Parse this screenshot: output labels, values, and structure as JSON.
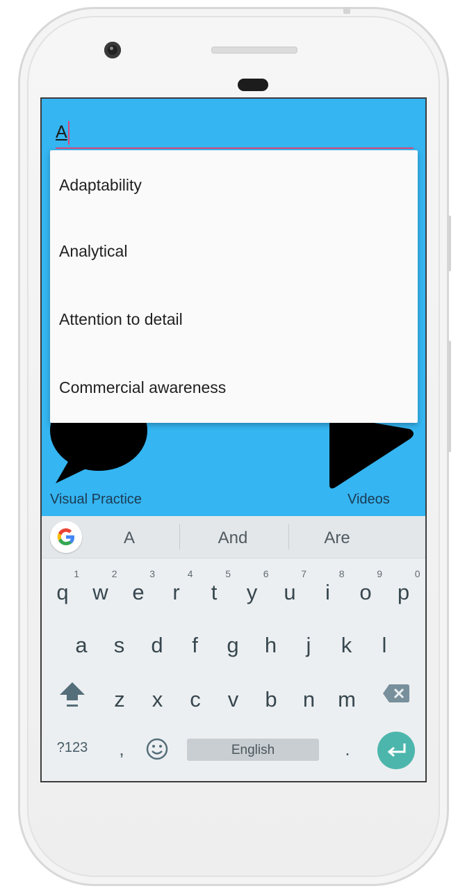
{
  "input": {
    "value": "A"
  },
  "autocomplete": {
    "items": [
      "Adaptability",
      "Analytical",
      "Attention to detail",
      "Commercial awareness"
    ]
  },
  "tiles": {
    "left_caption": "Visual Practice",
    "right_caption": "Videos",
    "left_icon": "speech-bubble-icon",
    "right_icon": "play-icon"
  },
  "keyboard": {
    "suggestions": [
      "A",
      "And",
      "Are"
    ],
    "row1": [
      {
        "key": "q",
        "num": "1"
      },
      {
        "key": "w",
        "num": "2"
      },
      {
        "key": "e",
        "num": "3"
      },
      {
        "key": "r",
        "num": "4"
      },
      {
        "key": "t",
        "num": "5"
      },
      {
        "key": "y",
        "num": "6"
      },
      {
        "key": "u",
        "num": "7"
      },
      {
        "key": "i",
        "num": "8"
      },
      {
        "key": "o",
        "num": "9"
      },
      {
        "key": "p",
        "num": "0"
      }
    ],
    "row2": [
      "a",
      "s",
      "d",
      "f",
      "g",
      "h",
      "j",
      "k",
      "l"
    ],
    "row3": [
      "z",
      "x",
      "c",
      "v",
      "b",
      "n",
      "m"
    ],
    "symbols_label": "?123",
    "comma_label": ",",
    "period_label": ".",
    "space_label": "English"
  },
  "colors": {
    "screen_bg": "#35b5f1",
    "accent": "#e0457a",
    "enter_key": "#4db6ac"
  }
}
